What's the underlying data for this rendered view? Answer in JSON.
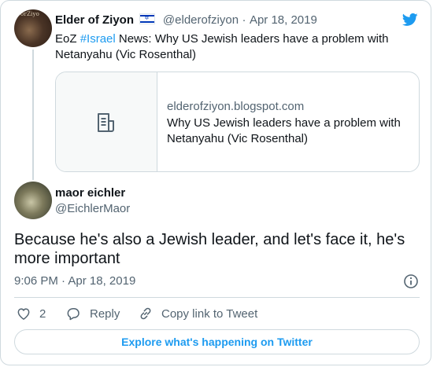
{
  "original_tweet": {
    "display_name": "Elder of Ziyon",
    "handle": "@elderofziyon",
    "separator": "·",
    "date": "Apr 18, 2019",
    "avatar_text": "orZiyo",
    "text_prefix": "EoZ ",
    "hashtag": "#Israel",
    "text_rest": " News: Why US Jewish leaders have a problem with Netanyahu (Vic Rosenthal)",
    "link_card": {
      "domain": "elderofziyon.blogspot.com",
      "title": "Why US Jewish leaders have a problem with Netanyahu (Vic Rosenthal)"
    }
  },
  "reply_tweet": {
    "display_name": "maor eichler",
    "handle": "@EichlerMaor",
    "text": "Because he's also a Jewish leader, and let's face it, he's more important",
    "time": "9:06 PM",
    "separator": "·",
    "date": "Apr 18, 2019"
  },
  "actions": {
    "like_count": "2",
    "reply_label": "Reply",
    "copy_link_label": "Copy link to Tweet"
  },
  "explore_label": "Explore what's happening on Twitter",
  "colors": {
    "accent": "#1d9bf0",
    "text": "#0f1419",
    "muted": "#536471",
    "border": "#cfd9de"
  },
  "icons": [
    "twitter-bird-icon",
    "israel-flag-icon",
    "document-icon",
    "info-icon",
    "heart-icon",
    "reply-icon",
    "link-icon"
  ]
}
